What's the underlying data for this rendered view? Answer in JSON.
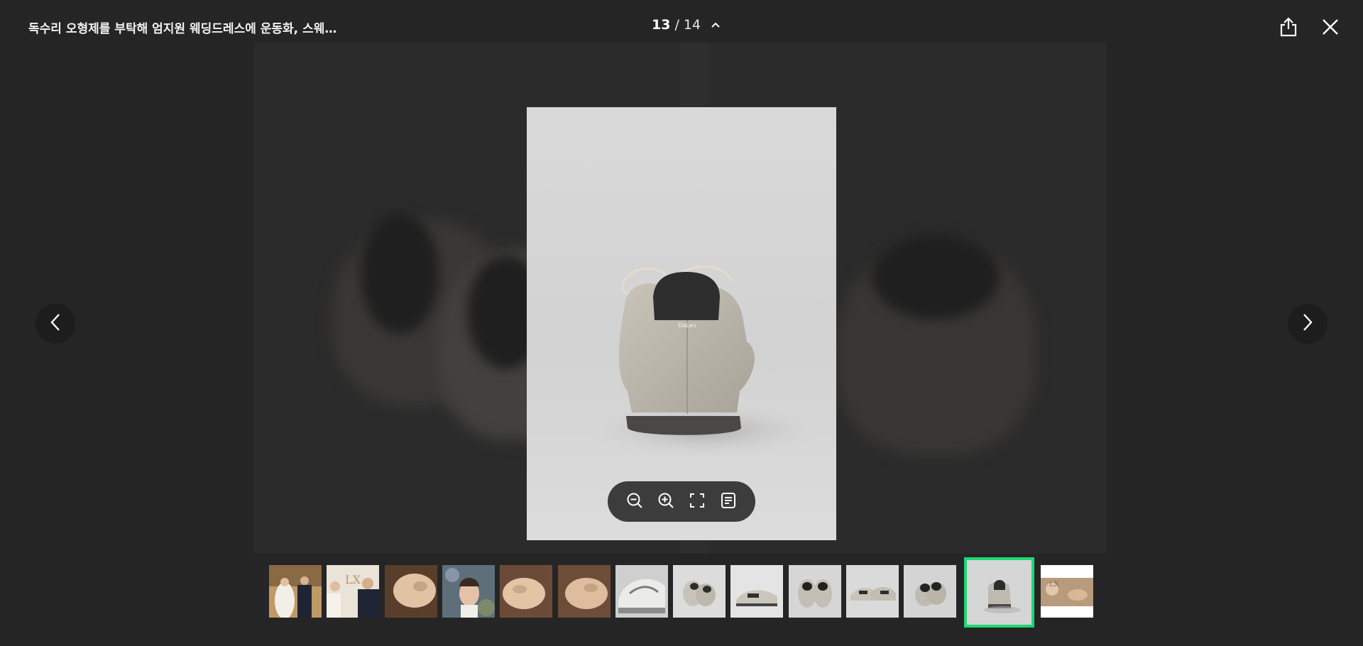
{
  "header": {
    "title": "독수리 오형제를 부탁해 엄지원 웨딩드레스에 운동화, 스웨…",
    "counter": {
      "current": "13",
      "separator": "/",
      "total": "14"
    }
  },
  "icons": {
    "share": "share-icon",
    "close": "close-icon",
    "prev": "chevron-left-icon",
    "next": "chevron-right-icon",
    "expand": "chevron-up-icon",
    "zoom_out": "zoom-out-icon",
    "zoom_in": "zoom-in-icon",
    "fullscreen": "fullscreen-icon",
    "caption": "caption-icon"
  },
  "photo": {
    "subject": "beige suede sneaker, rear view",
    "brand_mark": "DaLeo"
  },
  "thumbnails": {
    "count": 14,
    "active_index": 12,
    "accent_color": "#1ed675"
  },
  "colors": {
    "background": "#262626",
    "active_border": "#1ed675"
  }
}
